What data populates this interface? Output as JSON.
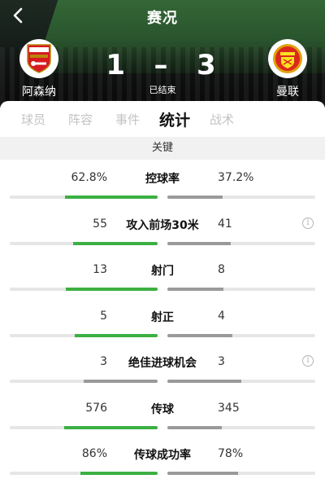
{
  "header": {
    "title": "赛况",
    "home_team": "阿森纳",
    "away_team": "曼联",
    "home_score": "1",
    "separator": "–",
    "away_score": "3",
    "status": "已结束"
  },
  "tabs": [
    {
      "label": "球员",
      "active": false
    },
    {
      "label": "阵容",
      "active": false
    },
    {
      "label": "事件",
      "active": false
    },
    {
      "label": "统计",
      "active": true
    },
    {
      "label": "战术",
      "active": false
    }
  ],
  "section": {
    "title": "关键"
  },
  "colors": {
    "winner": "#3cb043",
    "loser": "#9a9a9a",
    "track": "#e6e6e6"
  },
  "stats": [
    {
      "name": "控球率",
      "home": "62.8%",
      "away": "37.2%",
      "home_share": 0.628,
      "away_share": 0.372,
      "info": false
    },
    {
      "name": "攻入前场30米",
      "home": "55",
      "away": "41",
      "home_share": 0.57,
      "away_share": 0.43,
      "info": true
    },
    {
      "name": "射门",
      "home": "13",
      "away": "8",
      "home_share": 0.62,
      "away_share": 0.38,
      "info": false
    },
    {
      "name": "射正",
      "home": "5",
      "away": "4",
      "home_share": 0.56,
      "away_share": 0.44,
      "info": false
    },
    {
      "name": "绝佳进球机会",
      "home": "3",
      "away": "3",
      "home_share": 0.5,
      "away_share": 0.5,
      "info": true
    },
    {
      "name": "传球",
      "home": "576",
      "away": "345",
      "home_share": 0.63,
      "away_share": 0.37,
      "info": false
    },
    {
      "name": "传球成功率",
      "home": "86%",
      "away": "78%",
      "home_share": 0.52,
      "away_share": 0.48,
      "info": false
    }
  ]
}
